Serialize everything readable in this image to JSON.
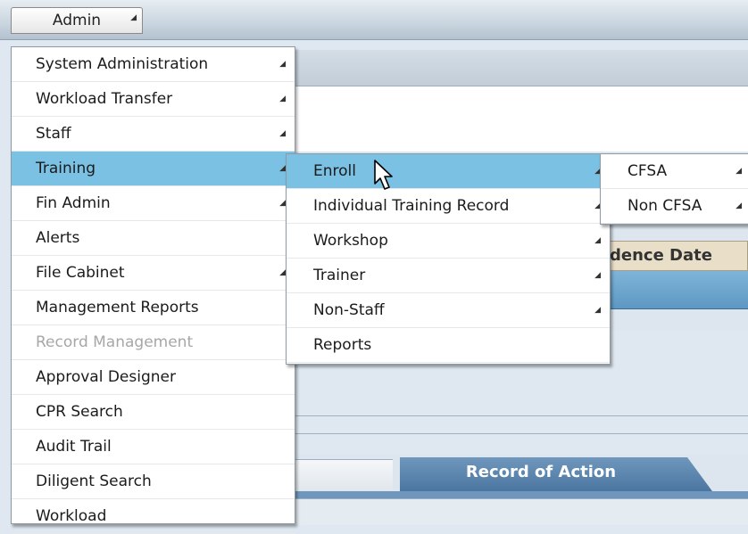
{
  "menubar": {
    "admin_label": "Admin"
  },
  "background": {
    "column_header": "dence Date",
    "tab_label": "Record of Action"
  },
  "admin_menu": {
    "items": [
      {
        "label": "System Administration",
        "submenu": true,
        "state": "normal"
      },
      {
        "label": "Workload Transfer",
        "submenu": true,
        "state": "normal"
      },
      {
        "label": "Staff",
        "submenu": true,
        "state": "normal"
      },
      {
        "label": "Training",
        "submenu": true,
        "state": "selected"
      },
      {
        "label": "Fin Admin",
        "submenu": true,
        "state": "normal"
      },
      {
        "label": "Alerts",
        "submenu": false,
        "state": "normal"
      },
      {
        "label": "File Cabinet",
        "submenu": true,
        "state": "normal"
      },
      {
        "label": "Management Reports",
        "submenu": false,
        "state": "normal"
      },
      {
        "label": "Record Management",
        "submenu": false,
        "state": "disabled"
      },
      {
        "label": "Approval Designer",
        "submenu": false,
        "state": "normal"
      },
      {
        "label": "CPR Search",
        "submenu": false,
        "state": "normal"
      },
      {
        "label": "Audit Trail",
        "submenu": false,
        "state": "normal"
      },
      {
        "label": "Diligent Search",
        "submenu": false,
        "state": "normal"
      },
      {
        "label": "Workload",
        "submenu": false,
        "state": "normal"
      }
    ]
  },
  "training_menu": {
    "items": [
      {
        "label": "Enroll",
        "submenu": true,
        "state": "selected"
      },
      {
        "label": "Individual Training Record",
        "submenu": true,
        "state": "normal"
      },
      {
        "label": "Workshop",
        "submenu": true,
        "state": "normal"
      },
      {
        "label": "Trainer",
        "submenu": true,
        "state": "normal"
      },
      {
        "label": "Non-Staff",
        "submenu": true,
        "state": "normal"
      },
      {
        "label": "Reports",
        "submenu": false,
        "state": "normal"
      }
    ]
  },
  "enroll_menu": {
    "items": [
      {
        "label": "CFSA",
        "submenu": true,
        "state": "normal"
      },
      {
        "label": "Non CFSA",
        "submenu": true,
        "state": "normal"
      }
    ]
  },
  "colors": {
    "selected_bg": "#7ac1e3",
    "disabled_text": "#a7a7a7",
    "tab_active": "#4b76a0"
  }
}
